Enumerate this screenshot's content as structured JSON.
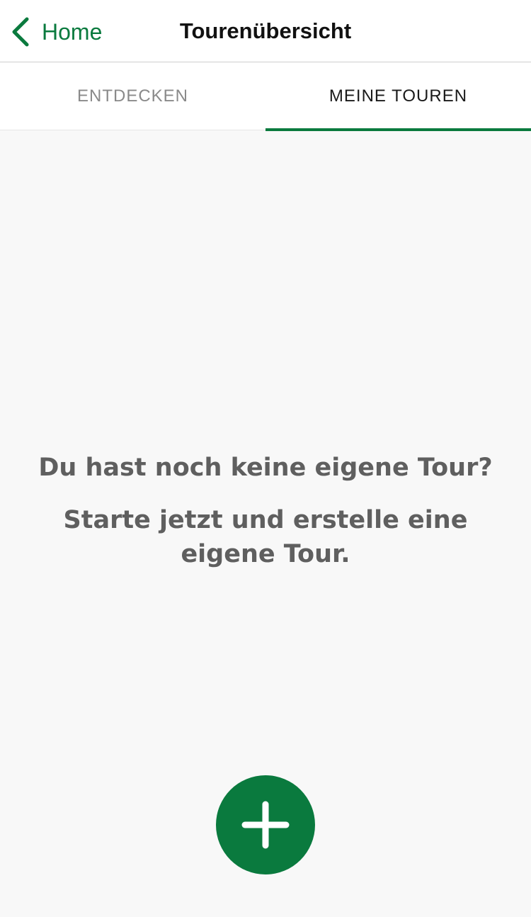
{
  "nav": {
    "back_label": "Home",
    "title": "Tourenübersicht"
  },
  "tabs": [
    {
      "label": "ENTDECKEN",
      "active": false
    },
    {
      "label": "MEINE TOUREN",
      "active": true
    }
  ],
  "empty_state": {
    "title": "Du hast noch keine eigene Tour?",
    "subtitle": "Starte jetzt und erstelle eine eigene Tour."
  },
  "icons": {
    "back": "chevron-left-icon",
    "add": "plus-icon"
  },
  "colors": {
    "accent": "#0a7a3e",
    "background": "#f8f8f8",
    "text_muted": "#5f5f5f",
    "tab_inactive": "#8a8a8a"
  }
}
